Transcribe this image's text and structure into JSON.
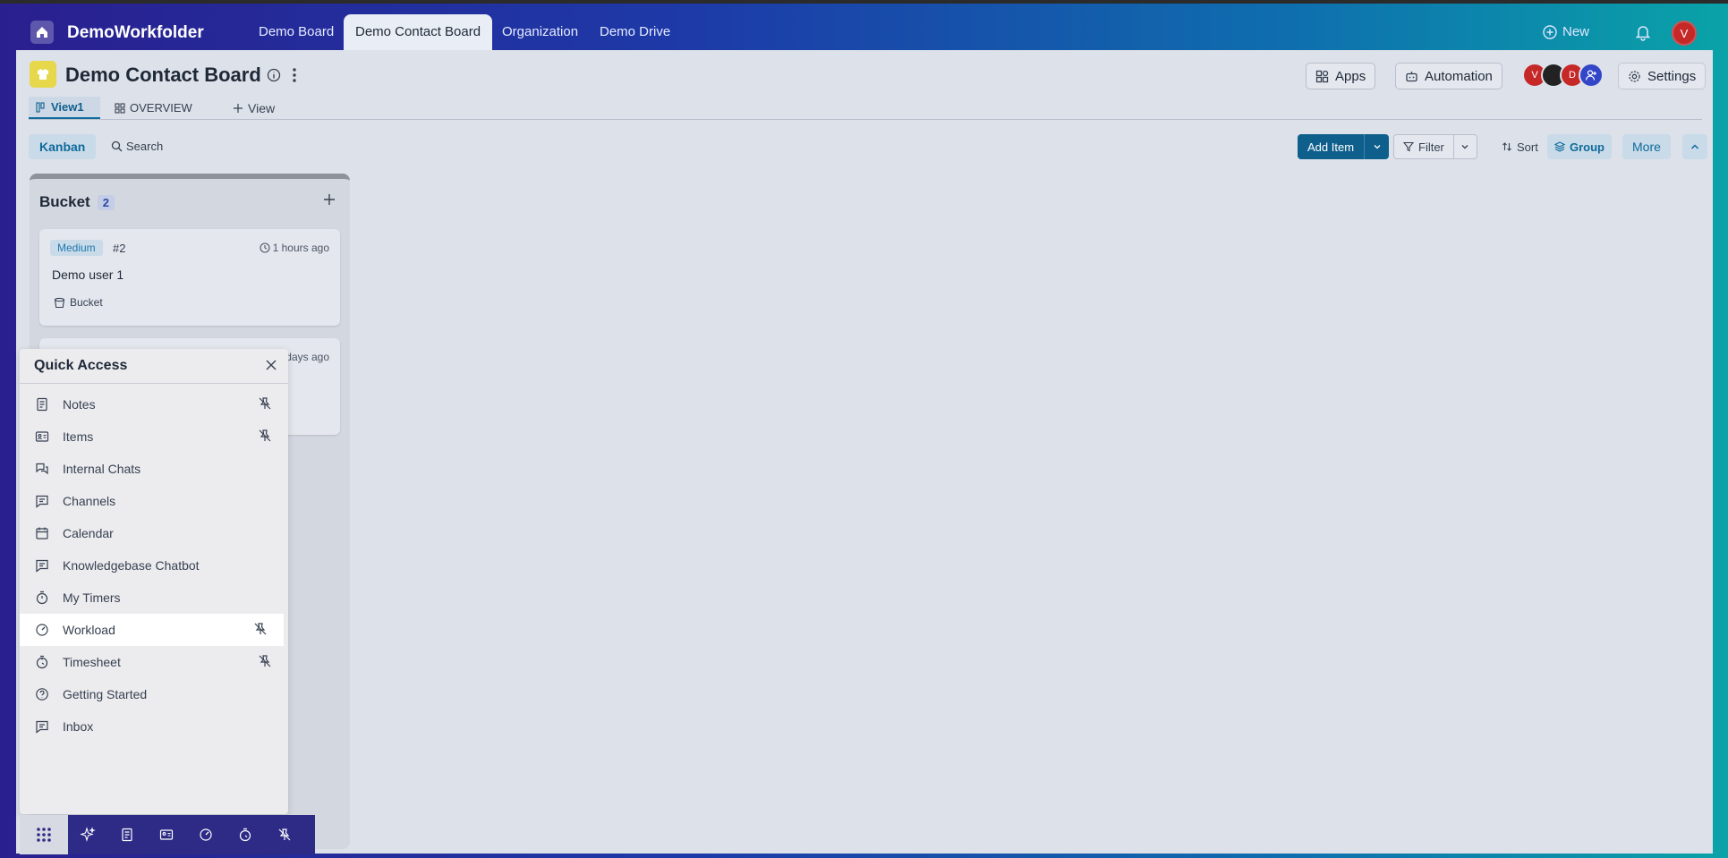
{
  "app": {
    "brand": "DemoWorkfolder",
    "nav_tabs": [
      "Demo Board",
      "Demo Contact Board",
      "Organization",
      "Demo Drive"
    ],
    "active_tab": "Demo Contact Board",
    "new_label": "New",
    "user_initial": "V"
  },
  "board": {
    "title": "Demo Contact Board",
    "apps_label": "Apps",
    "automation_label": "Automation",
    "settings_label": "Settings",
    "members": [
      "V",
      "",
      "D"
    ],
    "views": {
      "view1": "View1",
      "overview": "OVERVIEW",
      "add_view": "View"
    }
  },
  "toolbar": {
    "kanban": "Kanban",
    "search": "Search",
    "add_item": "Add Item",
    "filter": "Filter",
    "sort": "Sort",
    "group": "Group",
    "more": "More"
  },
  "column": {
    "title": "Bucket",
    "count": "2",
    "cards": [
      {
        "priority": "Medium",
        "number": "#2",
        "time": "1 hours ago",
        "name": "Demo user 1",
        "group": "Bucket"
      },
      {
        "time_partial": "days ago"
      }
    ]
  },
  "quick_access": {
    "title": "Quick Access",
    "items": [
      {
        "label": "Notes",
        "pinned": true
      },
      {
        "label": "Items",
        "pinned": true
      },
      {
        "label": "Internal Chats",
        "pinned": false
      },
      {
        "label": "Channels",
        "pinned": false
      },
      {
        "label": "Calendar",
        "pinned": false
      },
      {
        "label": "Knowledgebase Chatbot",
        "pinned": false
      },
      {
        "label": "My Timers",
        "pinned": false
      },
      {
        "label": "Workload",
        "pinned": true,
        "highlighted": true
      },
      {
        "label": "Timesheet",
        "pinned": true
      },
      {
        "label": "Getting Started",
        "pinned": false
      },
      {
        "label": "Inbox",
        "pinned": false
      }
    ]
  },
  "colors": {
    "accent": "#0f5f8c",
    "dock": "#2e2b86",
    "avatar_red": "#c62828",
    "avatar_blue": "#3346c8"
  }
}
